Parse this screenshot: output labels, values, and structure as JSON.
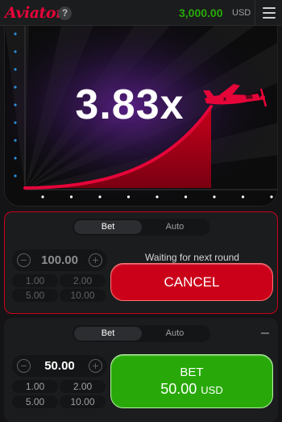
{
  "header": {
    "logo": "Aviator",
    "help": "?",
    "balance": "3,000.00",
    "currency": "USD"
  },
  "game": {
    "multiplier": "3.83x"
  },
  "panel1": {
    "tabs": [
      "Bet",
      "Auto"
    ],
    "amount": "100.00",
    "quick": [
      "1.00",
      "2.00",
      "5.00",
      "10.00"
    ],
    "status": "Waiting for next round",
    "action": "CANCEL"
  },
  "panel2": {
    "tabs": [
      "Bet",
      "Auto"
    ],
    "amount": "50.00",
    "quick": [
      "1.00",
      "2.00",
      "5.00",
      "10.00"
    ],
    "action_line1": "BET",
    "action_amount": "50.00",
    "action_currency": "USD"
  },
  "colors": {
    "brand_red": "#e50539",
    "cancel_red": "#cb011a",
    "bet_green": "#28a909",
    "balance_green": "#28a909"
  }
}
